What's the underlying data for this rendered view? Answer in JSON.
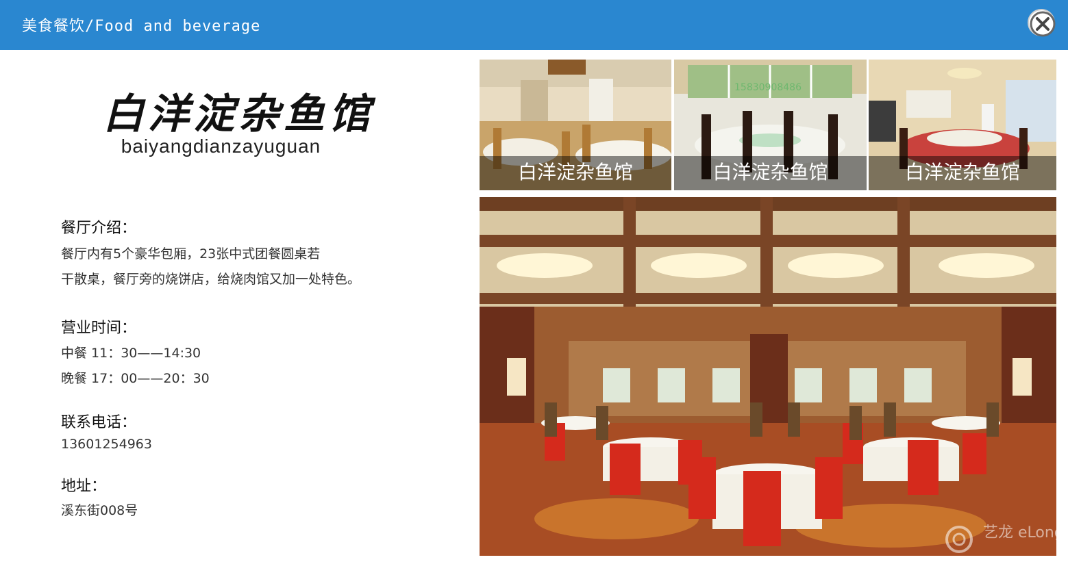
{
  "header": {
    "title": "美食餐饮/Food and beverage",
    "close_icon": "close-icon",
    "color": "#2a87d0"
  },
  "logo": {
    "name_cn": "白洋淀杂鱼馆",
    "name_pinyin": "baiyangdianzayuguan"
  },
  "intro": {
    "heading": "餐厅介绍：",
    "lines": [
      "餐厅内有5个豪华包厢，23张中式团餐圆桌若",
      "干散桌，餐厅旁的烧饼店，给烧肉馆又加一处特色。"
    ]
  },
  "hours": {
    "heading": "营业时间：",
    "lines": [
      "中餐 11：30——14:30",
      "晚餐 17：00——20：30"
    ]
  },
  "contact": {
    "heading": "联系电话：",
    "phone": "13601254963"
  },
  "address": {
    "heading": "地址：",
    "value": "溪东街008号"
  },
  "gallery": {
    "thumbnails": [
      {
        "caption": "白洋淀杂鱼馆"
      },
      {
        "caption": "白洋淀杂鱼馆"
      },
      {
        "caption": "白洋淀杂鱼馆"
      }
    ],
    "thumb2_watermark": "15830908486"
  },
  "main_photo": {
    "watermark": "艺龙 eLong"
  }
}
